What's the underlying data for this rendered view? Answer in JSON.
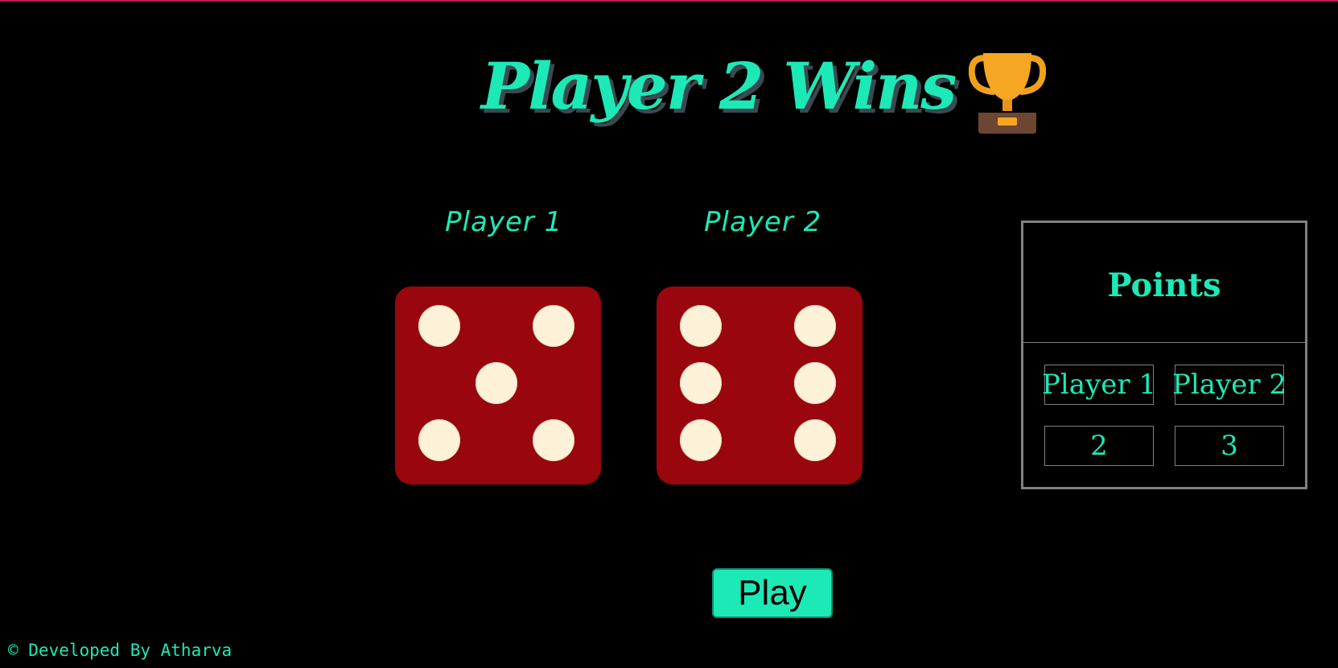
{
  "game": {
    "title": "Player 2 Wins",
    "title_icon": "trophy-icon"
  },
  "players": [
    {
      "label": "Player 1",
      "die_value": 5
    },
    {
      "label": "Player 2",
      "die_value": 6
    }
  ],
  "points": {
    "title": "Points",
    "headers": [
      "Player 1",
      "Player 2"
    ],
    "scores": [
      "2",
      "3"
    ]
  },
  "controls": {
    "play_label": "Play"
  },
  "footer": {
    "text": "© Developed By Atharva"
  },
  "colors": {
    "accent": "#1de9b6",
    "die": "#99060d",
    "pip": "#fdf1d7",
    "background": "#000000",
    "top_border": "#c2185b"
  }
}
